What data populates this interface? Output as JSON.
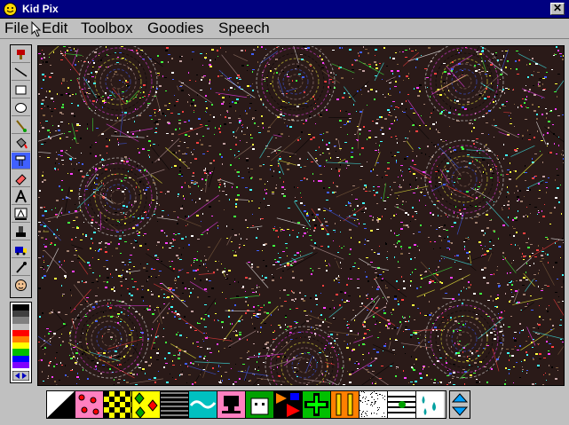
{
  "window": {
    "title": "Kid Pix",
    "close_glyph": "✕"
  },
  "menu": {
    "items": [
      "File",
      "Edit",
      "Toolbox",
      "Goodies",
      "Speech"
    ]
  },
  "toolbox": {
    "tools": [
      "stamp-top-icon",
      "line-icon",
      "rectangle-icon",
      "oval-icon",
      "paint-brush-icon",
      "paint-bucket-icon",
      "electric-mixer-icon",
      "eraser-icon",
      "text-icon",
      "alphabet-stamp-icon",
      "rubber-stamp-icon",
      "moving-van-icon",
      "eyedropper-icon",
      "face-icon"
    ],
    "selected": "electric-mixer-icon"
  },
  "palette": {
    "colors": [
      "#000000",
      "#404040",
      "#808080",
      "#c0c0c0",
      "#ff0000",
      "#ff8000",
      "#ffff00",
      "#00c000",
      "#0000ff",
      "#8000ff"
    ]
  },
  "options": {
    "items": [
      "diagonal-split-option",
      "dots-option",
      "checker-option",
      "diamonds-option",
      "stripes-option",
      "wave-option",
      "monitor-option",
      "face-option",
      "shapes-option",
      "cross-option",
      "bars-option",
      "speckle-option",
      "lines-option",
      "drops-option"
    ],
    "selected": "bars-option"
  },
  "colors": {
    "title_bg": "#000080",
    "chrome": "#c0c0c0",
    "selected_tool": "#4060ff",
    "selected_option": "#ff8000"
  }
}
